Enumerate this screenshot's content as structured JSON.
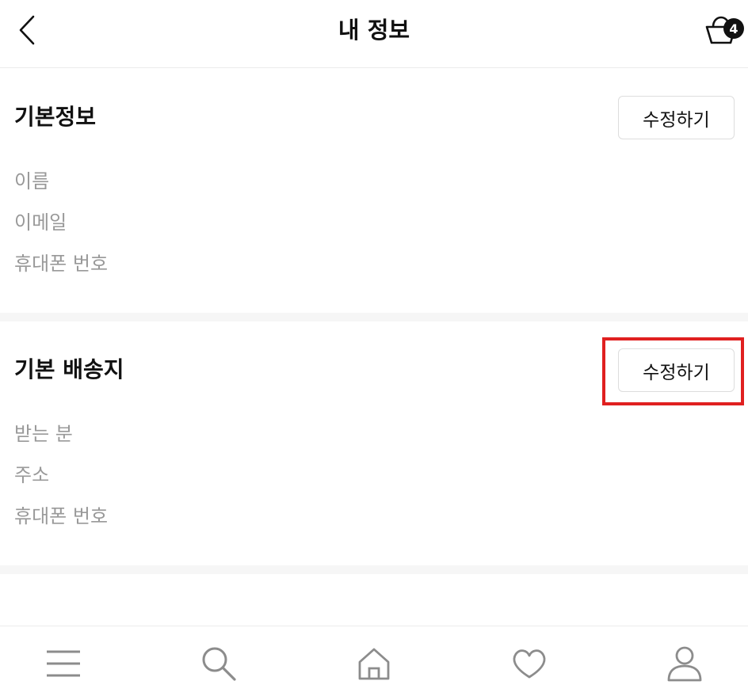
{
  "header": {
    "title": "내 정보",
    "back_icon": "chevron-left-icon",
    "cart_icon": "shopping-basket-icon",
    "cart_count": "4"
  },
  "basic_info": {
    "title": "기본정보",
    "edit_label": "수정하기",
    "fields": [
      "이름",
      "이메일",
      "휴대폰 번호"
    ]
  },
  "default_shipping": {
    "title": "기본 배송지",
    "edit_label": "수정하기",
    "fields": [
      "받는 분",
      "주소",
      "휴대폰 번호"
    ]
  },
  "bottom_nav": {
    "items": [
      {
        "icon": "menu-icon"
      },
      {
        "icon": "search-icon"
      },
      {
        "icon": "home-icon"
      },
      {
        "icon": "heart-icon"
      },
      {
        "icon": "user-icon"
      }
    ]
  },
  "colors": {
    "text": "#111111",
    "muted": "#999999",
    "nav_icon": "#8c8c8c",
    "highlight": "#e02020"
  }
}
